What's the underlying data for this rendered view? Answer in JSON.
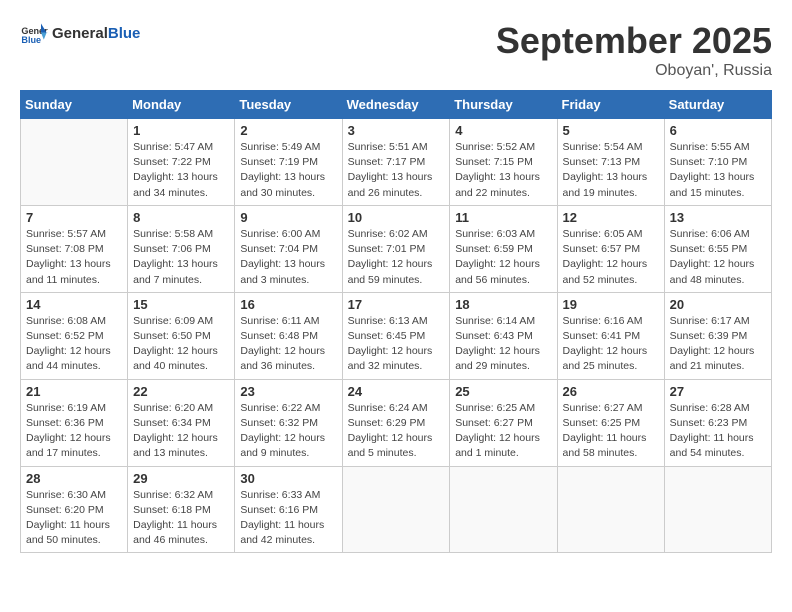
{
  "header": {
    "logo_general": "General",
    "logo_blue": "Blue",
    "month_title": "September 2025",
    "location": "Oboyan', Russia"
  },
  "days_of_week": [
    "Sunday",
    "Monday",
    "Tuesday",
    "Wednesday",
    "Thursday",
    "Friday",
    "Saturday"
  ],
  "weeks": [
    [
      {
        "day": "",
        "info": ""
      },
      {
        "day": "1",
        "info": "Sunrise: 5:47 AM\nSunset: 7:22 PM\nDaylight: 13 hours\nand 34 minutes."
      },
      {
        "day": "2",
        "info": "Sunrise: 5:49 AM\nSunset: 7:19 PM\nDaylight: 13 hours\nand 30 minutes."
      },
      {
        "day": "3",
        "info": "Sunrise: 5:51 AM\nSunset: 7:17 PM\nDaylight: 13 hours\nand 26 minutes."
      },
      {
        "day": "4",
        "info": "Sunrise: 5:52 AM\nSunset: 7:15 PM\nDaylight: 13 hours\nand 22 minutes."
      },
      {
        "day": "5",
        "info": "Sunrise: 5:54 AM\nSunset: 7:13 PM\nDaylight: 13 hours\nand 19 minutes."
      },
      {
        "day": "6",
        "info": "Sunrise: 5:55 AM\nSunset: 7:10 PM\nDaylight: 13 hours\nand 15 minutes."
      }
    ],
    [
      {
        "day": "7",
        "info": "Sunrise: 5:57 AM\nSunset: 7:08 PM\nDaylight: 13 hours\nand 11 minutes."
      },
      {
        "day": "8",
        "info": "Sunrise: 5:58 AM\nSunset: 7:06 PM\nDaylight: 13 hours\nand 7 minutes."
      },
      {
        "day": "9",
        "info": "Sunrise: 6:00 AM\nSunset: 7:04 PM\nDaylight: 13 hours\nand 3 minutes."
      },
      {
        "day": "10",
        "info": "Sunrise: 6:02 AM\nSunset: 7:01 PM\nDaylight: 12 hours\nand 59 minutes."
      },
      {
        "day": "11",
        "info": "Sunrise: 6:03 AM\nSunset: 6:59 PM\nDaylight: 12 hours\nand 56 minutes."
      },
      {
        "day": "12",
        "info": "Sunrise: 6:05 AM\nSunset: 6:57 PM\nDaylight: 12 hours\nand 52 minutes."
      },
      {
        "day": "13",
        "info": "Sunrise: 6:06 AM\nSunset: 6:55 PM\nDaylight: 12 hours\nand 48 minutes."
      }
    ],
    [
      {
        "day": "14",
        "info": "Sunrise: 6:08 AM\nSunset: 6:52 PM\nDaylight: 12 hours\nand 44 minutes."
      },
      {
        "day": "15",
        "info": "Sunrise: 6:09 AM\nSunset: 6:50 PM\nDaylight: 12 hours\nand 40 minutes."
      },
      {
        "day": "16",
        "info": "Sunrise: 6:11 AM\nSunset: 6:48 PM\nDaylight: 12 hours\nand 36 minutes."
      },
      {
        "day": "17",
        "info": "Sunrise: 6:13 AM\nSunset: 6:45 PM\nDaylight: 12 hours\nand 32 minutes."
      },
      {
        "day": "18",
        "info": "Sunrise: 6:14 AM\nSunset: 6:43 PM\nDaylight: 12 hours\nand 29 minutes."
      },
      {
        "day": "19",
        "info": "Sunrise: 6:16 AM\nSunset: 6:41 PM\nDaylight: 12 hours\nand 25 minutes."
      },
      {
        "day": "20",
        "info": "Sunrise: 6:17 AM\nSunset: 6:39 PM\nDaylight: 12 hours\nand 21 minutes."
      }
    ],
    [
      {
        "day": "21",
        "info": "Sunrise: 6:19 AM\nSunset: 6:36 PM\nDaylight: 12 hours\nand 17 minutes."
      },
      {
        "day": "22",
        "info": "Sunrise: 6:20 AM\nSunset: 6:34 PM\nDaylight: 12 hours\nand 13 minutes."
      },
      {
        "day": "23",
        "info": "Sunrise: 6:22 AM\nSunset: 6:32 PM\nDaylight: 12 hours\nand 9 minutes."
      },
      {
        "day": "24",
        "info": "Sunrise: 6:24 AM\nSunset: 6:29 PM\nDaylight: 12 hours\nand 5 minutes."
      },
      {
        "day": "25",
        "info": "Sunrise: 6:25 AM\nSunset: 6:27 PM\nDaylight: 12 hours\nand 1 minute."
      },
      {
        "day": "26",
        "info": "Sunrise: 6:27 AM\nSunset: 6:25 PM\nDaylight: 11 hours\nand 58 minutes."
      },
      {
        "day": "27",
        "info": "Sunrise: 6:28 AM\nSunset: 6:23 PM\nDaylight: 11 hours\nand 54 minutes."
      }
    ],
    [
      {
        "day": "28",
        "info": "Sunrise: 6:30 AM\nSunset: 6:20 PM\nDaylight: 11 hours\nand 50 minutes."
      },
      {
        "day": "29",
        "info": "Sunrise: 6:32 AM\nSunset: 6:18 PM\nDaylight: 11 hours\nand 46 minutes."
      },
      {
        "day": "30",
        "info": "Sunrise: 6:33 AM\nSunset: 6:16 PM\nDaylight: 11 hours\nand 42 minutes."
      },
      {
        "day": "",
        "info": ""
      },
      {
        "day": "",
        "info": ""
      },
      {
        "day": "",
        "info": ""
      },
      {
        "day": "",
        "info": ""
      }
    ]
  ]
}
